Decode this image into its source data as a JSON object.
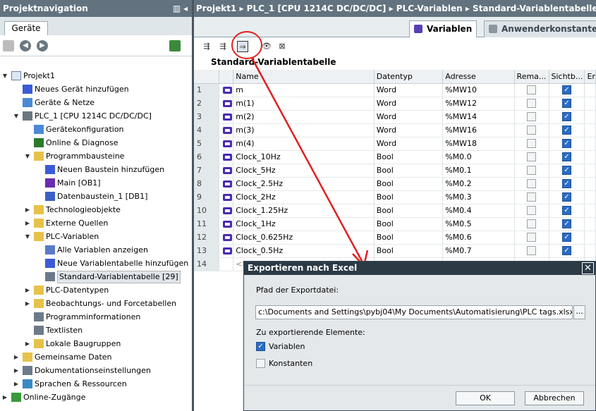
{
  "left": {
    "title": "Projektnavigation",
    "tab": "Geräte",
    "tree": [
      {
        "label": "Projekt1",
        "expanded": "down",
        "icon": "project-icon"
      },
      {
        "label": "Neues Gerät hinzufügen",
        "icon": "add-device-icon"
      },
      {
        "label": "Geräte & Netze",
        "icon": "network-icon"
      },
      {
        "label": "PLC_1 [CPU 1214C DC/DC/DC]",
        "expanded": "down",
        "icon": "plc-icon"
      },
      {
        "label": "Gerätekonfiguration",
        "icon": "device-config-icon"
      },
      {
        "label": "Online & Diagnose",
        "icon": "diagnostics-icon"
      },
      {
        "label": "Programmbausteine",
        "expanded": "down",
        "icon": "folder-icon"
      },
      {
        "label": "Neuen Baustein hinzufügen",
        "icon": "add-block-icon"
      },
      {
        "label": "Main [OB1]",
        "icon": "ob-block-icon"
      },
      {
        "label": "Datenbaustein_1 [DB1]",
        "icon": "db-block-icon"
      },
      {
        "label": "Technologieobjekte",
        "expanded": "right",
        "icon": "folder-icon"
      },
      {
        "label": "Externe Quellen",
        "expanded": "right",
        "icon": "folder-icon"
      },
      {
        "label": "PLC-Variablen",
        "expanded": "down",
        "icon": "folder-icon"
      },
      {
        "label": "Alle Variablen anzeigen",
        "icon": "show-all-vars-icon"
      },
      {
        "label": "Neue Variablentabelle hinzufügen",
        "icon": "add-var-table-icon"
      },
      {
        "label": "Standard-Variablentabelle [29]",
        "icon": "var-table-icon"
      },
      {
        "label": "PLC-Datentypen",
        "expanded": "right",
        "icon": "folder-icon"
      },
      {
        "label": "Beobachtungs- und Forcetabellen",
        "expanded": "right",
        "icon": "folder-icon"
      },
      {
        "label": "Programminformationen",
        "icon": "program-info-icon"
      },
      {
        "label": "Textlisten",
        "icon": "text-list-icon"
      },
      {
        "label": "Lokale Baugruppen",
        "expanded": "right",
        "icon": "folder-icon"
      },
      {
        "label": "Gemeinsame Daten",
        "expanded": "right",
        "icon": "folder-icon"
      },
      {
        "label": "Dokumentationseinstellungen",
        "expanded": "right",
        "icon": "doc-settings-icon"
      },
      {
        "label": "Sprachen & Ressourcen",
        "expanded": "right",
        "icon": "languages-icon"
      },
      {
        "label": "Online-Zugänge",
        "expanded": "right",
        "icon": "online-access-icon"
      }
    ]
  },
  "right": {
    "breadcrumb": [
      "Projekt1",
      "PLC_1 [CPU 1214C DC/DC/DC]",
      "PLC-Variablen",
      "Standard-Variablentabelle"
    ],
    "tabs": [
      "Variablen",
      "Anwenderkonstanten"
    ],
    "table_title": "Standard-Variablentabelle",
    "columns": [
      "",
      "Name",
      "Datentyp",
      "Adresse",
      "Rema...",
      "Sichtb...",
      "Er"
    ],
    "rows": [
      {
        "n": "1",
        "name": "m",
        "type": "Word",
        "addr": "%MW10",
        "rema": false,
        "sicht": true
      },
      {
        "n": "2",
        "name": "m(1)",
        "type": "Word",
        "addr": "%MW12",
        "rema": false,
        "sicht": true
      },
      {
        "n": "3",
        "name": "m(2)",
        "type": "Word",
        "addr": "%MW14",
        "rema": false,
        "sicht": true
      },
      {
        "n": "4",
        "name": "m(3)",
        "type": "Word",
        "addr": "%MW16",
        "rema": false,
        "sicht": true
      },
      {
        "n": "5",
        "name": "m(4)",
        "type": "Word",
        "addr": "%MW18",
        "rema": false,
        "sicht": true
      },
      {
        "n": "6",
        "name": "Clock_10Hz",
        "type": "Bool",
        "addr": "%M0.0",
        "rema": false,
        "sicht": true
      },
      {
        "n": "7",
        "name": "Clock_5Hz",
        "type": "Bool",
        "addr": "%M0.1",
        "rema": false,
        "sicht": true
      },
      {
        "n": "8",
        "name": "Clock_2.5Hz",
        "type": "Bool",
        "addr": "%M0.2",
        "rema": false,
        "sicht": true
      },
      {
        "n": "9",
        "name": "Clock_2Hz",
        "type": "Bool",
        "addr": "%M0.3",
        "rema": false,
        "sicht": true
      },
      {
        "n": "10",
        "name": "Clock_1.25Hz",
        "type": "Bool",
        "addr": "%M0.4",
        "rema": false,
        "sicht": true
      },
      {
        "n": "11",
        "name": "Clock_1Hz",
        "type": "Bool",
        "addr": "%M0.5",
        "rema": false,
        "sicht": true
      },
      {
        "n": "12",
        "name": "Clock_0.625Hz",
        "type": "Bool",
        "addr": "%M0.6",
        "rema": false,
        "sicht": true
      },
      {
        "n": "13",
        "name": "Clock_0.5Hz",
        "type": "Bool",
        "addr": "%M0.7",
        "rema": false,
        "sicht": true
      }
    ],
    "new_row_num": "14",
    "new_row_placeholder": "<H"
  },
  "dialog": {
    "title": "Exportieren nach Excel",
    "path_label": "Pfad der Exportdatei:",
    "path_value": "c:\\Documents and Settings\\pybj04\\My Documents\\Automatisierung\\PLC tags.xlsx",
    "browse": "...",
    "elements_label": "Zu exportierende Elemente:",
    "opt_variablen": "Variablen",
    "opt_konstanten": "Konstanten",
    "ok": "OK",
    "cancel": "Abbrechen"
  }
}
